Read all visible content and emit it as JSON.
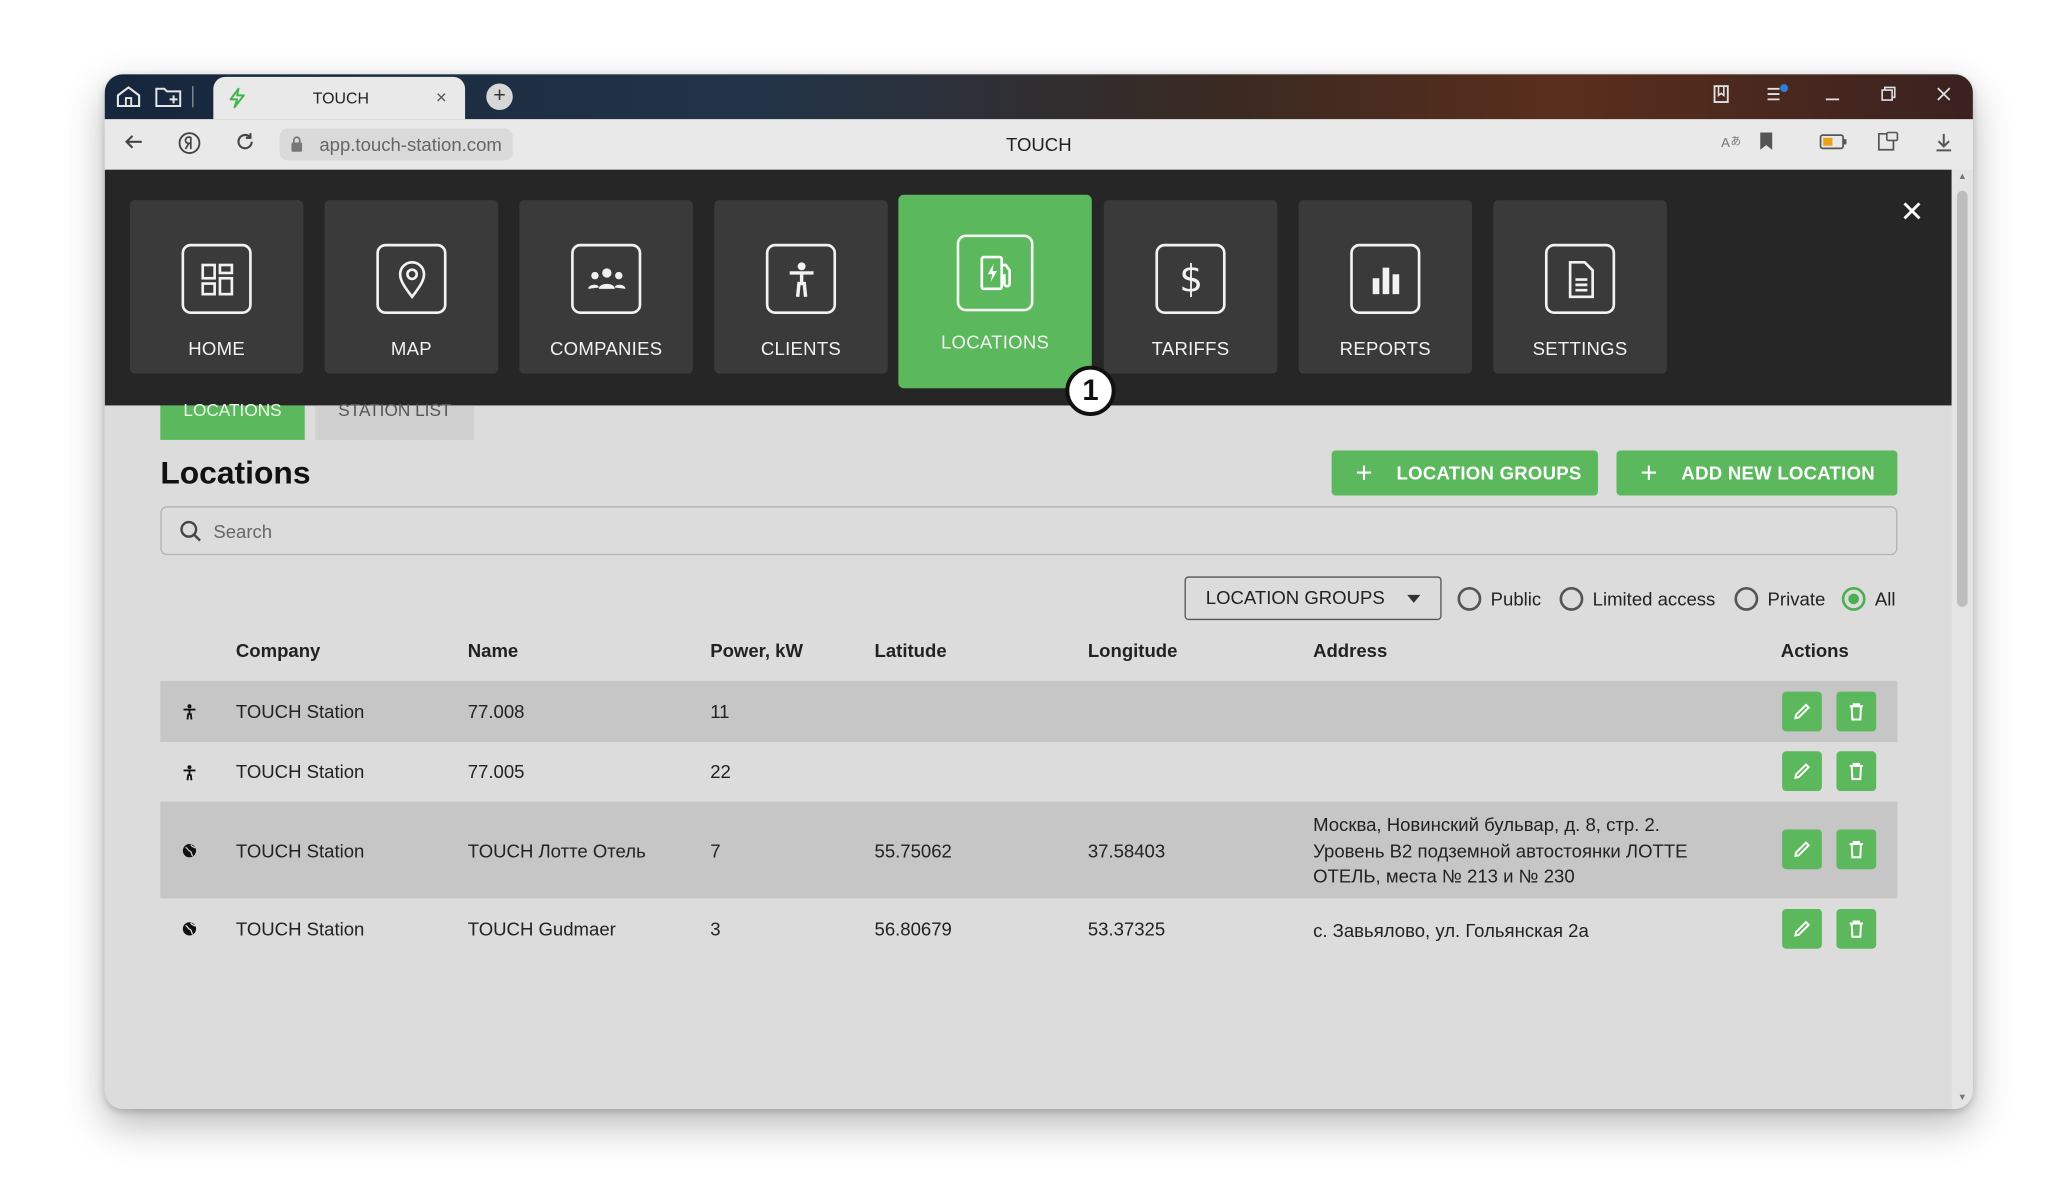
{
  "browser": {
    "tab_title": "TOUCH",
    "tab_close": "×",
    "new_tab": "+",
    "url": "app.touch-station.com",
    "page_title": "TOUCH"
  },
  "nav": {
    "items": [
      {
        "label": "HOME",
        "icon": "dashboard-icon"
      },
      {
        "label": "MAP",
        "icon": "map-pin-icon"
      },
      {
        "label": "COMPANIES",
        "icon": "people-icon"
      },
      {
        "label": "CLIENTS",
        "icon": "person-icon"
      },
      {
        "label": "LOCATIONS",
        "icon": "charging-station-icon",
        "active": true
      },
      {
        "label": "TARIFFS",
        "icon": "dollar-icon"
      },
      {
        "label": "REPORTS",
        "icon": "bar-chart-icon"
      },
      {
        "label": "SETTINGS",
        "icon": "document-icon"
      }
    ],
    "badge": "1",
    "close": "✕"
  },
  "subtabs": [
    "LOCATIONS",
    "STATION LIST"
  ],
  "page": {
    "title": "Locations",
    "btn_groups": "LOCATION GROUPS",
    "btn_add": "ADD NEW LOCATION",
    "search_placeholder": "Search",
    "dropdown": "LOCATION GROUPS",
    "radios": [
      "Public",
      "Limited access",
      "Private",
      "All"
    ],
    "radio_selected": "All"
  },
  "table": {
    "headers": [
      "Company",
      "Name",
      "Power, kW",
      "Latitude",
      "Longitude",
      "Address",
      "Actions"
    ],
    "rows": [
      {
        "icon": "person-icon",
        "company": "TOUCH Station",
        "name": "77.008",
        "power": "11",
        "lat": "",
        "lon": "",
        "address": [
          "",
          "",
          ""
        ]
      },
      {
        "icon": "person-icon",
        "company": "TOUCH Station",
        "name": "77.005",
        "power": "22",
        "lat": "",
        "lon": "",
        "address": [
          "",
          "",
          ""
        ]
      },
      {
        "icon": "globe-icon",
        "company": "TOUCH Station",
        "name": "TOUCH Лотте Отель",
        "power": "7",
        "lat": "55.75062",
        "lon": "37.58403",
        "address": [
          "Москва, Новинский бульвар, д. 8, стр. 2.",
          "Уровень В2 подземной автостоянки ЛОТТЕ",
          "ОТЕЛЬ, места № 213 и № 230"
        ]
      },
      {
        "icon": "globe-icon",
        "company": "TOUCH Station",
        "name": "TOUCH Gudmaer",
        "power": "3",
        "lat": "56.80679",
        "lon": "53.37325",
        "address": [
          "с. Завьялово, ул. Гольянская 2а",
          "",
          ""
        ]
      }
    ]
  },
  "colors": {
    "accent": "#5cb85c",
    "nav_bg": "#262626",
    "tile_bg": "#3a3a3a"
  }
}
